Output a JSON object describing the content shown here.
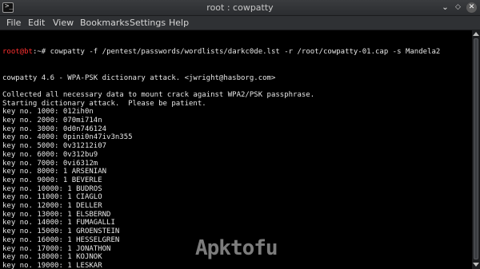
{
  "window": {
    "title": "root : cowpatty",
    "minimize_glyph": "⌄",
    "maximize_glyph": "◇",
    "close_glyph": "✕",
    "app_icon_glyph": ">_"
  },
  "menu": {
    "file": "File",
    "edit": "Edit",
    "view": "View",
    "bookmarks": "Bookmarks",
    "settings": "Settings",
    "help": "Help"
  },
  "terminal": {
    "prompt_user": "root@bt",
    "prompt_rest": ":~# ",
    "command": "cowpatty -f /pentest/passwords/wordlists/darkc0de.lst -r /root/cowpatty-01.cap -s Mandela2",
    "lines": [
      "cowpatty 4.6 - WPA-PSK dictionary attack. <jwright@hasborg.com>",
      "",
      "Collected all necessary data to mount crack against WPA2/PSK passphrase.",
      "Starting dictionary attack.  Please be patient.",
      "key no. 1000: 012ih0n",
      "key no. 2000: 070mi714n",
      "key no. 3000: 0d0n746124",
      "key no. 4000: 0pini0n47iv3n355",
      "key no. 5000: 0v31212i07",
      "key no. 6000: 0v312bu9",
      "key no. 7000: 0vi6312m",
      "key no. 8000: 1 ARSENIAN",
      "key no. 9000: 1 BEVERLE",
      "key no. 10000: 1 BUDROS",
      "key no. 11000: 1 CIAGLO",
      "key no. 12000: 1 DELLER",
      "key no. 13000: 1 ELSBERND",
      "key no. 14000: 1 FUMAGALLI",
      "key no. 15000: 1 GROENSTEIN",
      "key no. 16000: 1 HESSELGREN",
      "key no. 17000: 1 JONATHON",
      "key no. 18000: 1 KOJNOK",
      "key no. 19000: 1 LESKAR"
    ]
  },
  "watermark": "Apktofu",
  "colors": {
    "prompt_user": "#ff3030",
    "terminal_text": "#e6e6e6",
    "terminal_bg": "#000000"
  }
}
